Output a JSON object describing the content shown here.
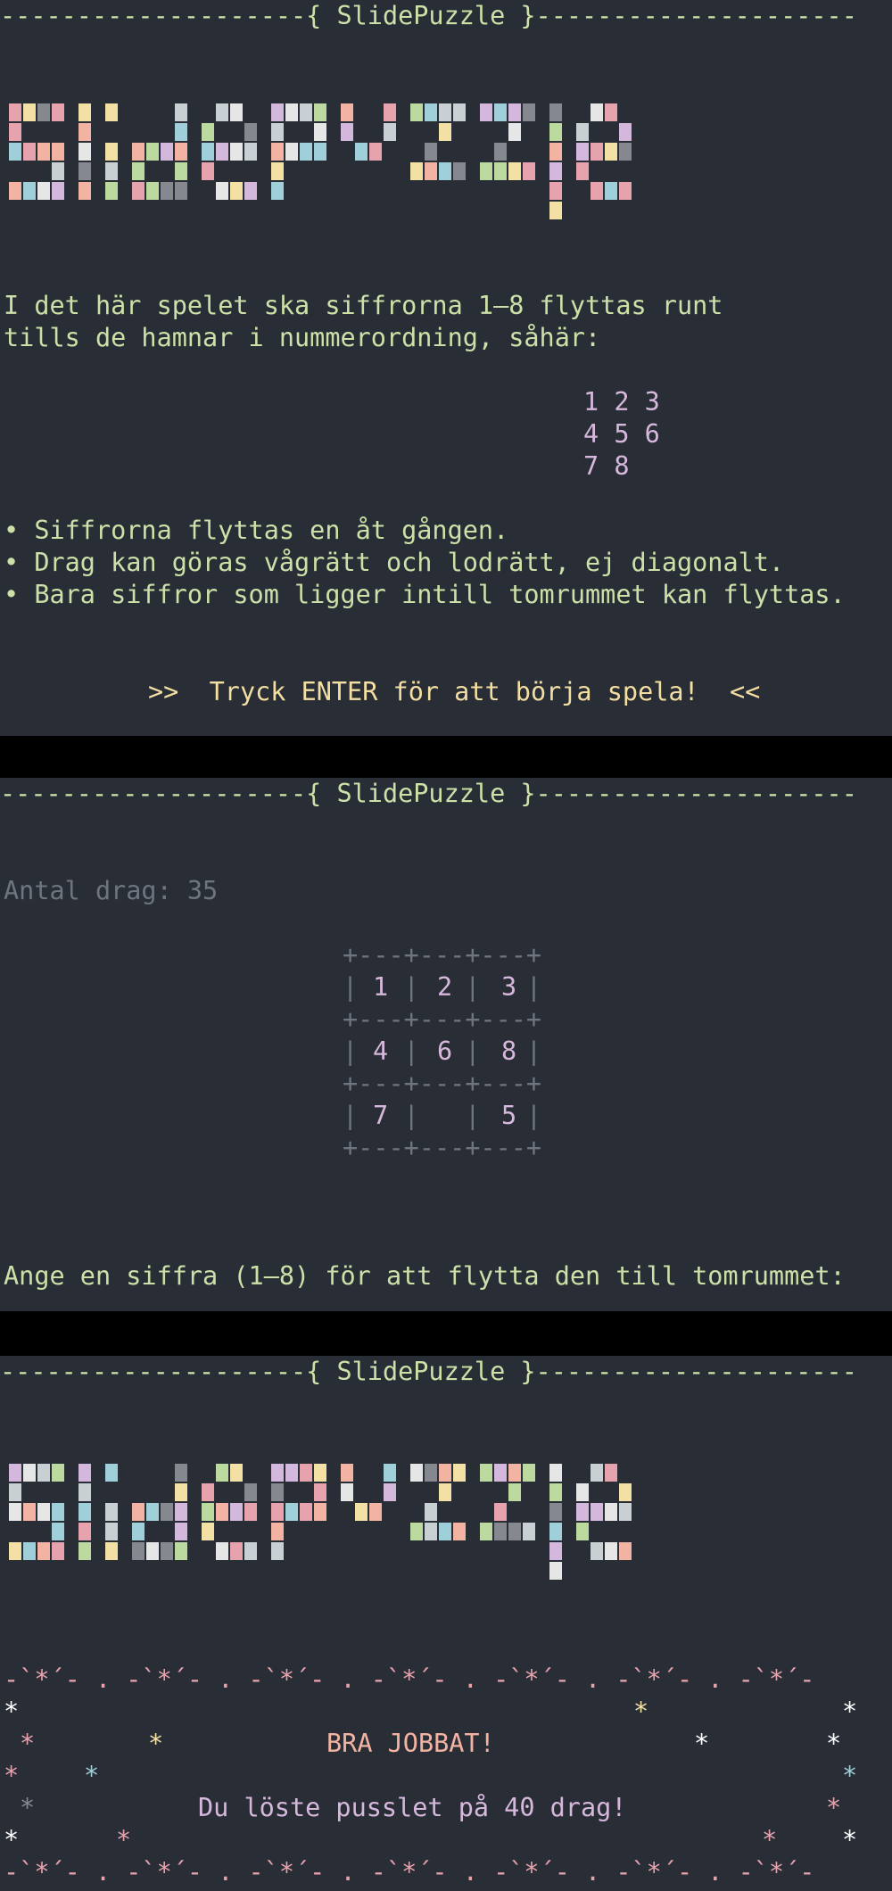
{
  "title_bar": "--------------------{ SlidePuzzle }---------------------",
  "intro": {
    "rules_line1": "I det här spelet ska siffrorna 1–8 flyttas runt",
    "rules_line2": "tills de hamnar i nummerordning, såhär:",
    "example_row1": "1 2 3",
    "example_row2": "4 5 6",
    "example_row3": "7 8",
    "bullet1": "• Siffrorna flyttas en åt gången.",
    "bullet2": "• Drag kan göras vågrätt och lodrätt, ej diagonalt.",
    "bullet3": "• Bara siffror som ligger intill tomrummet kan flyttas.",
    "prompt": ">>  Tryck ENTER för att börja spela!  <<"
  },
  "game": {
    "moves_label": "Antal drag: 35",
    "grid_border": "+---+---+---+",
    "board": [
      [
        "1",
        "2",
        "3"
      ],
      [
        "4",
        "6",
        "8"
      ],
      [
        "7",
        "",
        "5"
      ]
    ],
    "input_prompt": "Ange en siffra (1–8) för att flytta den till tomrummet:"
  },
  "win": {
    "border": "-`*´- . -`*´- . -`*´- . -`*´- . -`*´- . -`*´- . -`*´-",
    "headline": "BRA JOBBAT!",
    "summary": "Du löste pusslet på 40 drag!"
  },
  "colors": {
    "background": "#292d36",
    "title": "#cde0a8",
    "muted": "#6f7580",
    "tile_number": "#d6b8dc",
    "prompt": "#f4dfa2",
    "logo_palette": [
      "#9fcfd9",
      "#f2b3a3",
      "#e6a3ae",
      "#bcd9a0",
      "#f3e0a5",
      "#d4b7dd",
      "#c9d0d4",
      "#85898f",
      "#e6e6e6"
    ]
  }
}
